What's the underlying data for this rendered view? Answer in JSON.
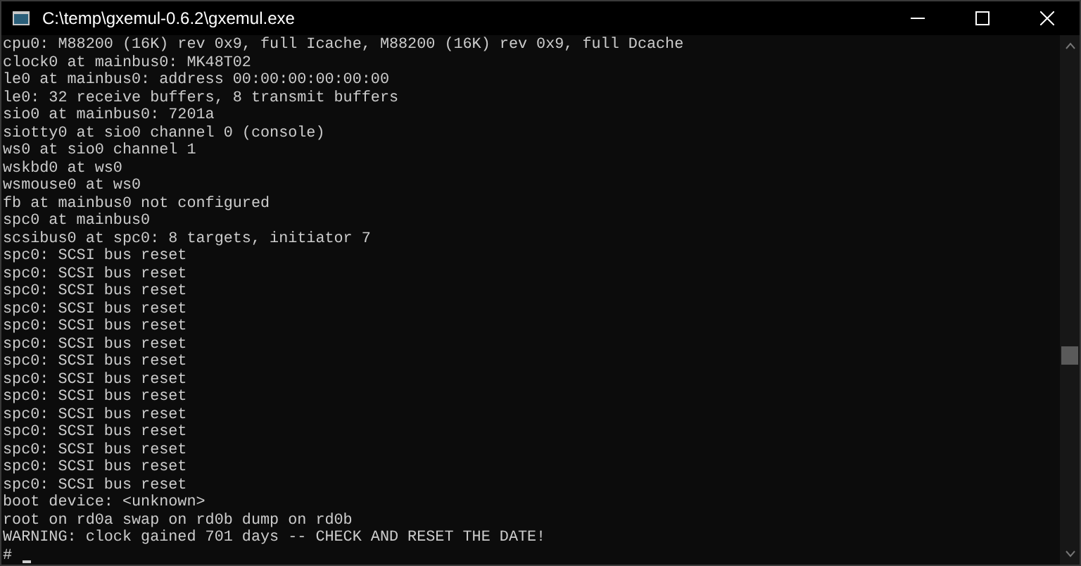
{
  "window": {
    "title": "C:\\temp\\gxemul-0.6.2\\gxemul.exe"
  },
  "console": {
    "lines": [
      "cpu0: M88200 (16K) rev 0x9, full Icache, M88200 (16K) rev 0x9, full Dcache",
      "clock0 at mainbus0: MK48T02",
      "le0 at mainbus0: address 00:00:00:00:00:00",
      "le0: 32 receive buffers, 8 transmit buffers",
      "sio0 at mainbus0: 7201a",
      "siotty0 at sio0 channel 0 (console)",
      "ws0 at sio0 channel 1",
      "wskbd0 at ws0",
      "wsmouse0 at ws0",
      "fb at mainbus0 not configured",
      "spc0 at mainbus0",
      "scsibus0 at spc0: 8 targets, initiator 7",
      "spc0: SCSI bus reset",
      "spc0: SCSI bus reset",
      "spc0: SCSI bus reset",
      "spc0: SCSI bus reset",
      "spc0: SCSI bus reset",
      "spc0: SCSI bus reset",
      "spc0: SCSI bus reset",
      "spc0: SCSI bus reset",
      "spc0: SCSI bus reset",
      "spc0: SCSI bus reset",
      "spc0: SCSI bus reset",
      "spc0: SCSI bus reset",
      "spc0: SCSI bus reset",
      "spc0: SCSI bus reset",
      "boot device: <unknown>",
      "root on rd0a swap on rd0b dump on rd0b",
      "WARNING: clock gained 701 days -- CHECK AND RESET THE DATE!"
    ],
    "prompt": "#"
  }
}
